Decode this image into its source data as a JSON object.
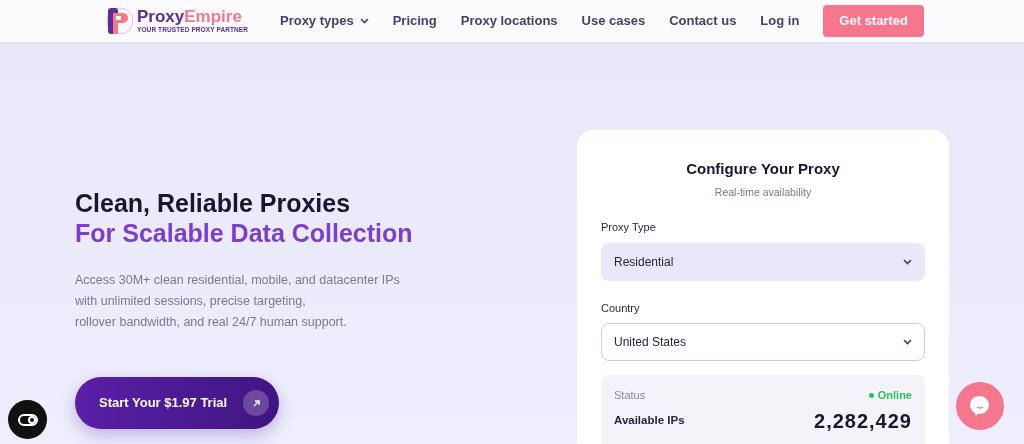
{
  "brand": {
    "name_part1": "Proxy",
    "name_part2": "Empire",
    "tagline": "YOUR TRUSTED PROXY PARTNER"
  },
  "nav": {
    "items": [
      {
        "label": "Proxy types",
        "dropdown": true
      },
      {
        "label": "Pricing",
        "dropdown": false
      },
      {
        "label": "Proxy locations",
        "dropdown": false
      },
      {
        "label": "Use cases",
        "dropdown": false
      },
      {
        "label": "Contact us",
        "dropdown": false
      },
      {
        "label": "Log in",
        "dropdown": false
      }
    ],
    "cta": "Get started"
  },
  "hero": {
    "title_line1": "Clean, Reliable Proxies",
    "title_line2": "For Scalable Data Collection",
    "description_lines": [
      "Access 30M+ clean residential, mobile, and datacenter IPs",
      "with unlimited sessions, precise targeting,",
      "rollover bandwidth, and real 24/7 human support."
    ],
    "button": "Start Your $1.97 Trial"
  },
  "configurator": {
    "title": "Configure Your Proxy",
    "subtitle": "Real-time availability",
    "fields": [
      {
        "label": "Proxy Type",
        "value": "Residential",
        "kind": "filled"
      },
      {
        "label": "Country",
        "value": "United States",
        "kind": "outlined"
      }
    ],
    "status_label": "Status",
    "status_value": "Online",
    "online": true,
    "ips_label": "Available IPs",
    "ips_value": "2,282,429"
  }
}
